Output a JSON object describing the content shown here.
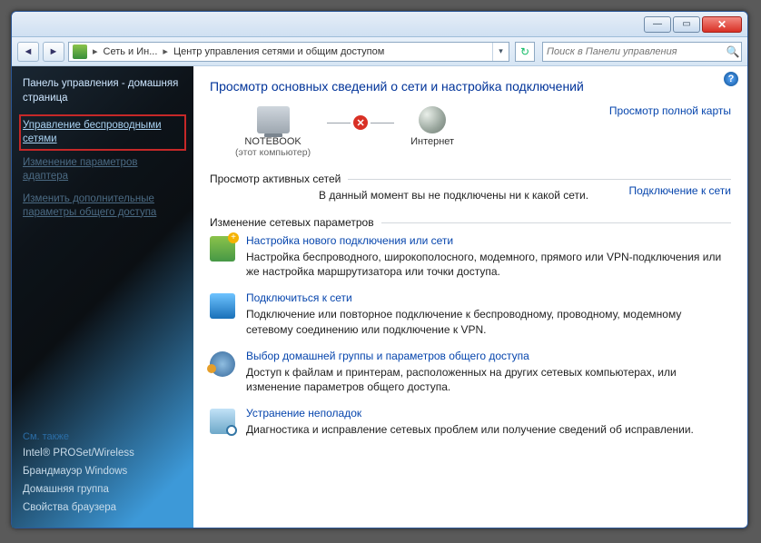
{
  "titlebar": {
    "min": "—",
    "max": "▭",
    "close": "✕"
  },
  "address": {
    "crumb1": "Сеть и Ин...",
    "crumb2": "Центр управления сетями и общим доступом"
  },
  "search": {
    "placeholder": "Поиск в Панели управления"
  },
  "sidebar": {
    "home": "Панель управления - домашняя страница",
    "links": [
      "Управление беспроводными сетями",
      "Изменение параметров адаптера",
      "Изменить дополнительные параметры общего доступа"
    ],
    "seealso_h": "См. также",
    "seealso": [
      "Intel® PROSet/Wireless",
      "Брандмауэр Windows",
      "Домашняя группа",
      "Свойства браузера"
    ]
  },
  "main": {
    "title": "Просмотр основных сведений о сети и настройка подключений",
    "map_link": "Просмотр полной карты",
    "node_this": "NOTEBOOK",
    "node_this_sub": "(этот компьютер)",
    "node_internet": "Интернет",
    "active_h": "Просмотр активных сетей",
    "connect_link": "Подключение к сети",
    "active_note": "В данный момент вы не подключены ни к какой сети.",
    "change_h": "Изменение сетевых параметров",
    "tasks": [
      {
        "title": "Настройка нового подключения или сети",
        "desc": "Настройка беспроводного, широкополосного, модемного, прямого или VPN-подключения или же настройка маршрутизатора или точки доступа."
      },
      {
        "title": "Подключиться к сети",
        "desc": "Подключение или повторное подключение к беспроводному, проводному, модемному сетевому соединению или подключение к VPN."
      },
      {
        "title": "Выбор домашней группы и параметров общего доступа",
        "desc": "Доступ к файлам и принтерам, расположенных на других сетевых компьютерах, или изменение параметров общего доступа."
      },
      {
        "title": "Устранение неполадок",
        "desc": "Диагностика и исправление сетевых проблем или получение сведений об исправлении."
      }
    ]
  }
}
